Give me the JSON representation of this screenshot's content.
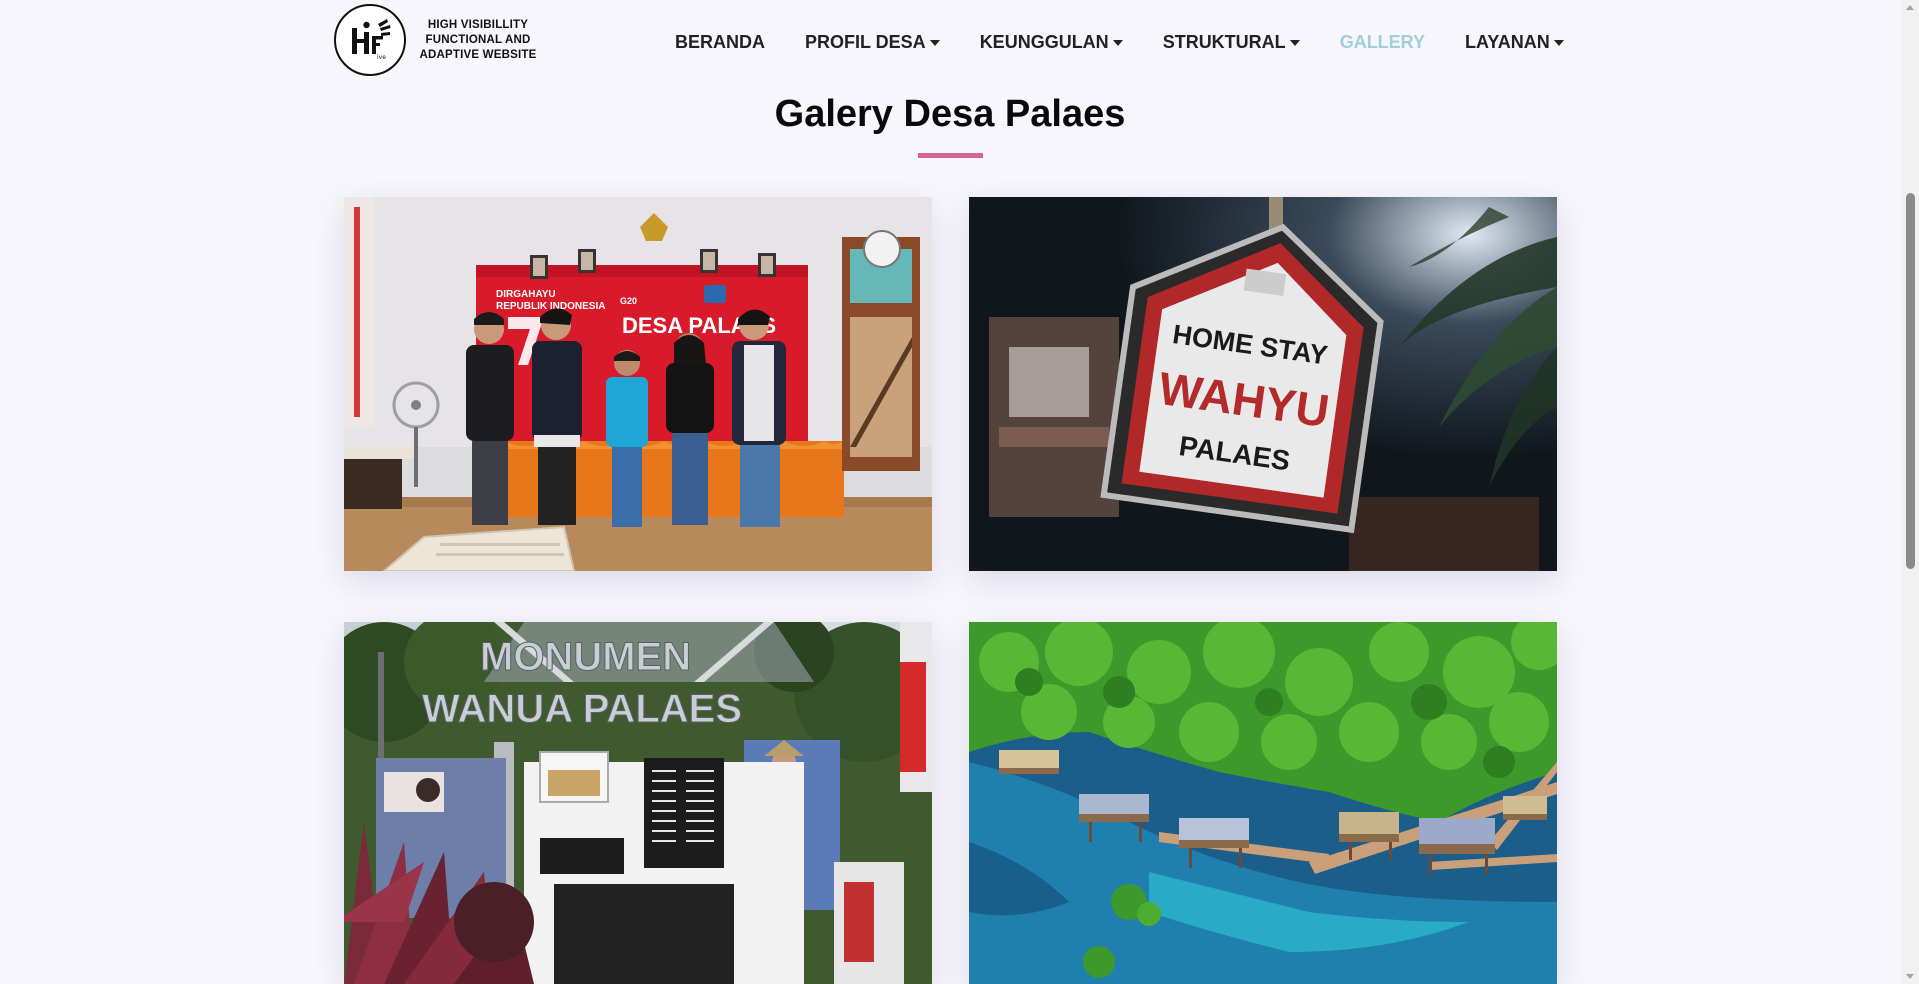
{
  "header": {
    "logo": {
      "mark": "HF",
      "text": "HIGH VISIBILLITY\nFUNCTIONAL AND\nADAPTIVE WEBSITE"
    },
    "nav": [
      {
        "label": "BERANDA",
        "dropdown": false,
        "active": false
      },
      {
        "label": "PROFIL DESA",
        "dropdown": true,
        "active": false
      },
      {
        "label": "KEUNGGULAN",
        "dropdown": true,
        "active": false
      },
      {
        "label": "STRUKTURAL",
        "dropdown": true,
        "active": false
      },
      {
        "label": "GALLERY",
        "dropdown": false,
        "active": true
      },
      {
        "label": "LAYANAN",
        "dropdown": true,
        "active": false
      }
    ]
  },
  "gallery": {
    "title": "Galery Desa Palaes",
    "photos": [
      {
        "subject": "group-photo",
        "banner_line1": "DIRGAHAYU",
        "banner_line2": "REPUBLIK INDONESIA",
        "banner_main": "DESA PALAES",
        "banner_logo": "G20"
      },
      {
        "subject": "homestay-sign",
        "sign_line1": "HOME STAY",
        "sign_line2": "WAHYU",
        "sign_line3": "PALAES"
      },
      {
        "subject": "monument",
        "sign_line1": "MONUMEN",
        "sign_line2": "WANUA PALAES"
      },
      {
        "subject": "mangrove-aerial"
      }
    ]
  },
  "colors": {
    "background": "#f6f6fc",
    "accent_underline": "#d4678b",
    "nav_active": "#9fd0da",
    "nav_text": "#222222"
  }
}
